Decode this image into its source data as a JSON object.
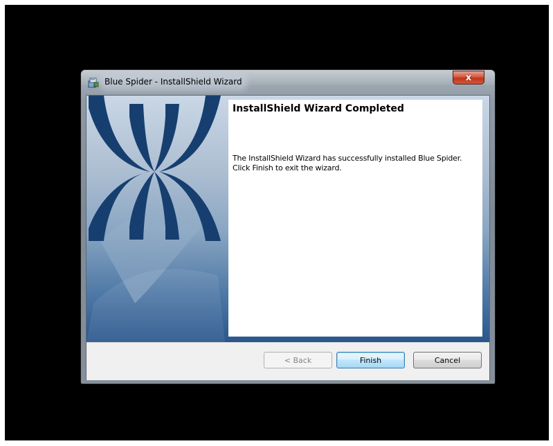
{
  "window": {
    "title": "Blue Spider - InstallShield Wizard",
    "close_label": "x"
  },
  "content": {
    "heading": "InstallShield Wizard Completed",
    "message_line1": "The InstallShield Wizard has successfully installed Blue Spider.",
    "message_line2": "Click Finish to exit the wizard."
  },
  "buttons": {
    "back": "< Back",
    "finish": "Finish",
    "cancel": "Cancel"
  },
  "colors": {
    "banner_dark_blue": "#0f3564",
    "default_button_border": "#3c7fb1",
    "close_button": "#c03518"
  },
  "icons": {
    "app": "installer-package-icon",
    "close": "close-icon"
  }
}
